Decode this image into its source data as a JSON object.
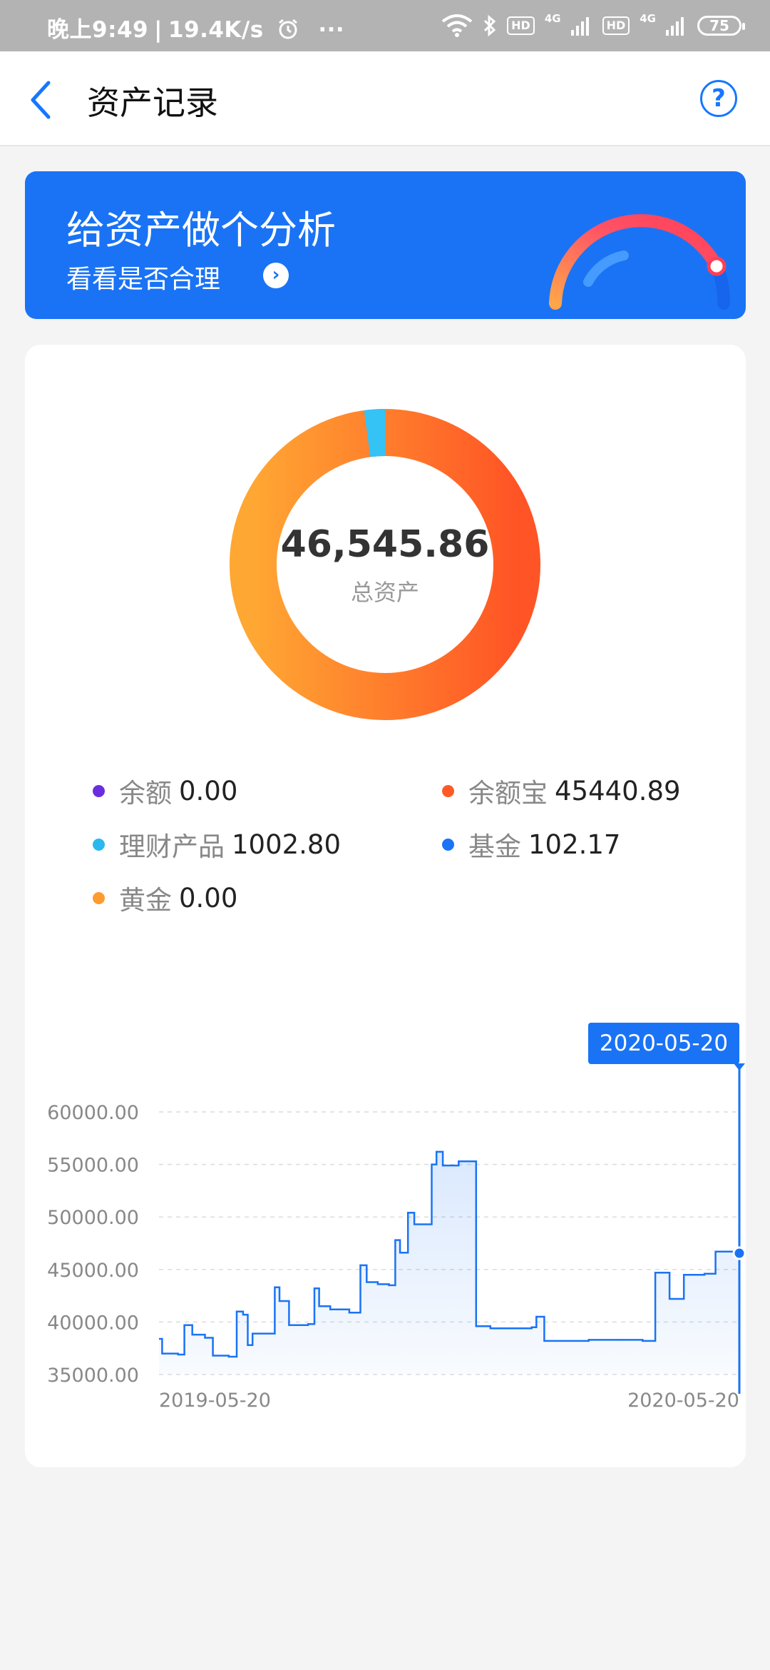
{
  "status_bar": {
    "time": "晚上9:49",
    "speed": "19.4K/s",
    "more": "···",
    "hd1": "HD",
    "net1": "4G",
    "hd2": "HD",
    "net2": "4G",
    "battery": "75"
  },
  "header": {
    "title": "资产记录",
    "help": "?"
  },
  "banner": {
    "title": "给资产做个分析",
    "subtitle": "看看是否合理",
    "arrow": "›"
  },
  "donut": {
    "total": "46,545.86",
    "total_label": "总资产"
  },
  "legend": [
    {
      "name": "余额",
      "value": "0.00",
      "color": "#6b2de0"
    },
    {
      "name": "余额宝",
      "value": "45440.89",
      "color": "#ff5a26"
    },
    {
      "name": "理财产品",
      "value": "1002.80",
      "color": "#2bb8f0"
    },
    {
      "name": "基金",
      "value": "102.17",
      "color": "#1a73f5"
    },
    {
      "name": "黄金",
      "value": "0.00",
      "color": "#ff9a2e"
    }
  ],
  "colors": {
    "accent": "#1a73f5",
    "donut_start": "#ffa733",
    "donut_end": "#ff5425",
    "donut_slice_fin": "#35c3f5"
  },
  "chart_data": {
    "type": "line",
    "title": "",
    "xlabel": "",
    "ylabel": "",
    "ylim": [
      35000,
      60000
    ],
    "y_ticks": [
      "60000.00",
      "55000.00",
      "50000.00",
      "45000.00",
      "40000.00",
      "35000.00"
    ],
    "x_ticks": [
      "2019-05-20",
      "2020-05-20"
    ],
    "tooltip": "2020-05-20",
    "grid": true,
    "series": [
      {
        "values": [
          [
            "2019-05-20",
            38400
          ],
          [
            "2019-05-22",
            37000
          ],
          [
            "2019-06-01",
            36900
          ],
          [
            "2019-06-05",
            39700
          ],
          [
            "2019-06-10",
            38800
          ],
          [
            "2019-06-18",
            38500
          ],
          [
            "2019-06-23",
            36800
          ],
          [
            "2019-07-03",
            36700
          ],
          [
            "2019-07-08",
            41000
          ],
          [
            "2019-07-12",
            40700
          ],
          [
            "2019-07-15",
            37800
          ],
          [
            "2019-07-18",
            38900
          ],
          [
            "2019-07-27",
            38900
          ],
          [
            "2019-08-01",
            43300
          ],
          [
            "2019-08-04",
            42000
          ],
          [
            "2019-08-10",
            39700
          ],
          [
            "2019-08-22",
            39800
          ],
          [
            "2019-08-26",
            43200
          ],
          [
            "2019-08-29",
            41500
          ],
          [
            "2019-09-05",
            41200
          ],
          [
            "2019-09-17",
            40900
          ],
          [
            "2019-09-24",
            45400
          ],
          [
            "2019-09-28",
            43800
          ],
          [
            "2019-10-05",
            43600
          ],
          [
            "2019-10-12",
            43500
          ],
          [
            "2019-10-16",
            47800
          ],
          [
            "2019-10-19",
            46600
          ],
          [
            "2019-10-24",
            50400
          ],
          [
            "2019-10-28",
            49300
          ],
          [
            "2019-11-05",
            49300
          ],
          [
            "2019-11-08",
            55000
          ],
          [
            "2019-11-11",
            56200
          ],
          [
            "2019-11-15",
            54900
          ],
          [
            "2019-11-25",
            55300
          ],
          [
            "2019-12-05",
            55300
          ],
          [
            "2019-12-06",
            39600
          ],
          [
            "2019-12-15",
            39400
          ],
          [
            "2020-01-10",
            39500
          ],
          [
            "2020-01-13",
            40500
          ],
          [
            "2020-01-18",
            38200
          ],
          [
            "2020-02-15",
            38300
          ],
          [
            "2020-03-20",
            38200
          ],
          [
            "2020-03-28",
            44700
          ],
          [
            "2020-04-06",
            42200
          ],
          [
            "2020-04-15",
            44500
          ],
          [
            "2020-04-28",
            44600
          ],
          [
            "2020-05-05",
            46700
          ],
          [
            "2020-05-20",
            46546
          ]
        ]
      }
    ]
  }
}
